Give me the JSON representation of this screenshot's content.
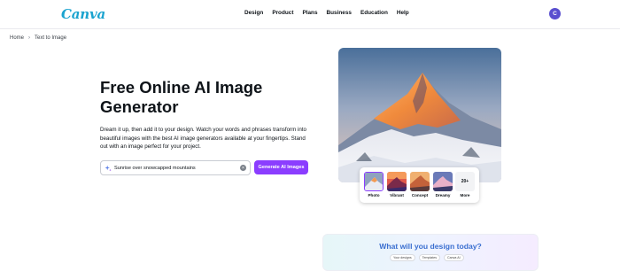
{
  "header": {
    "logo": "Canva",
    "nav": [
      "Design",
      "Product",
      "Plans",
      "Business",
      "Education",
      "Help"
    ],
    "avatar_initial": "C"
  },
  "breadcrumb": {
    "home": "Home",
    "separator": "›",
    "current": "Text to Image"
  },
  "hero": {
    "title": "Free Online AI Image Generator",
    "description": "Dream it up, then add it to your design. Watch your words and phrases transform into beautiful images with the best AI image generators available at your fingertips. Stand out with an image perfect for your project.",
    "search": {
      "value": "Sunrise over snowcapped mountains",
      "clear_icon": "×"
    },
    "generate_label": "Generate AI Images"
  },
  "styles": [
    {
      "label": "Photo",
      "selected": true
    },
    {
      "label": "Vibrant",
      "selected": false
    },
    {
      "label": "Concept",
      "selected": false
    },
    {
      "label": "Dreamy",
      "selected": false
    },
    {
      "label": "More",
      "count": "20+"
    }
  ],
  "promo": {
    "title": "What will you design today?",
    "chips": [
      "Your designs",
      "Templates",
      "Canva AI"
    ]
  },
  "colors": {
    "brand_purple": "#8b3dff",
    "logo_blue": "#1aa3cf",
    "promo_title": "#3a6fd0",
    "avatar": "#5a4fcf"
  }
}
